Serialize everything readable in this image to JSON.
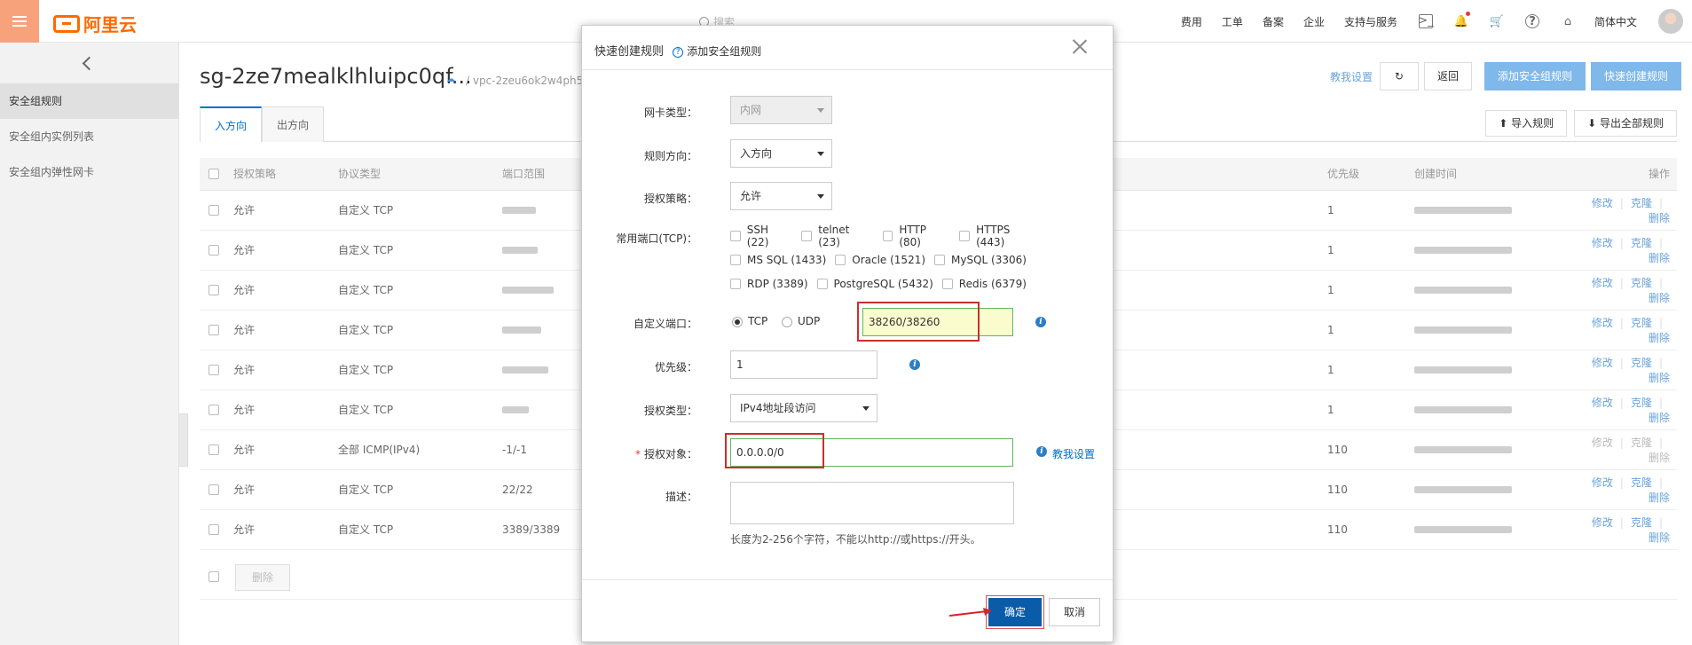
{
  "brand": {
    "name": "阿里云",
    "color": "#ff6a00"
  },
  "search": {
    "placeholder": "搜索"
  },
  "topnav": {
    "items": [
      "费用",
      "工单",
      "备案",
      "企业",
      "支持与服务"
    ],
    "language": "简体中文"
  },
  "sidebar": {
    "items": [
      {
        "label": "安全组规则",
        "active": true
      },
      {
        "label": "安全组内实例列表",
        "active": false
      },
      {
        "label": "安全组内弹性网卡",
        "active": false
      }
    ]
  },
  "page": {
    "title": "sg-2ze7mealklhluipc0qf...",
    "vpc": "/ vpc-2zeu6ok2w4ph54e",
    "guide_link": "教我设置",
    "back_btn": "返回",
    "add_rule_btn": "添加安全组规则",
    "quick_rule_btn": "快速创建规则",
    "tabs": [
      "入方向",
      "出方向"
    ],
    "import_btn": "导入规则",
    "export_btn": "导出全部规则",
    "delete_btn": "删除"
  },
  "table": {
    "headers": [
      "授权策略",
      "协议类型",
      "端口范围",
      "优先级",
      "创建时间",
      "操作"
    ],
    "rows": [
      {
        "policy": "允许",
        "protocol": "自定义 TCP",
        "port": "",
        "priority": "1",
        "ops_enabled": true
      },
      {
        "policy": "允许",
        "protocol": "自定义 TCP",
        "port": "",
        "priority": "1",
        "ops_enabled": true
      },
      {
        "policy": "允许",
        "protocol": "自定义 TCP",
        "port": "",
        "priority": "1",
        "ops_enabled": true
      },
      {
        "policy": "允许",
        "protocol": "自定义 TCP",
        "port": "",
        "priority": "1",
        "ops_enabled": true
      },
      {
        "policy": "允许",
        "protocol": "自定义 TCP",
        "port": "",
        "priority": "1",
        "ops_enabled": true
      },
      {
        "policy": "允许",
        "protocol": "自定义 TCP",
        "port": "",
        "priority": "1",
        "ops_enabled": true
      },
      {
        "policy": "允许",
        "protocol": "全部 ICMP(IPv4)",
        "port": "-1/-1",
        "priority": "110",
        "ops_enabled": false
      },
      {
        "policy": "允许",
        "protocol": "自定义 TCP",
        "port": "22/22",
        "priority": "110",
        "ops_enabled": true
      },
      {
        "policy": "允许",
        "protocol": "自定义 TCP",
        "port": "3389/3389",
        "priority": "110",
        "ops_enabled": true
      }
    ],
    "ops": [
      "修改",
      "克隆",
      "删除"
    ]
  },
  "modal": {
    "title": "快速创建规则",
    "subtitle": "添加安全组规则",
    "nic_label": "网卡类型：",
    "nic_value": "内网",
    "direction_label": "规则方向：",
    "direction_value": "入方向",
    "policy_label": "授权策略：",
    "policy_value": "允许",
    "common_ports_label": "常用端口(TCP)：",
    "common_ports": [
      [
        "SSH (22)",
        "telnet (23)",
        "HTTP (80)",
        "HTTPS (443)"
      ],
      [
        "MS SQL (1433)",
        "Oracle (1521)",
        "MySQL (3306)"
      ],
      [
        "RDP (3389)",
        "PostgreSQL (5432)",
        "Redis (6379)"
      ]
    ],
    "custom_port_label": "自定义端口：",
    "tcp_label": "TCP",
    "udp_label": "UDP",
    "custom_port_value": "38260/38260",
    "priority_label": "优先级：",
    "priority_value": "1",
    "auth_type_label": "授权类型：",
    "auth_type_value": "IPv4地址段访问",
    "auth_obj_label": "授权对象：",
    "auth_obj_value": "0.0.0.0/0",
    "auth_help": "教我设置",
    "desc_label": "描述：",
    "desc_value": "",
    "desc_hint": "长度为2-256个字符，不能以http://或https://开头。",
    "ok_btn": "确定",
    "cancel_btn": "取消"
  }
}
